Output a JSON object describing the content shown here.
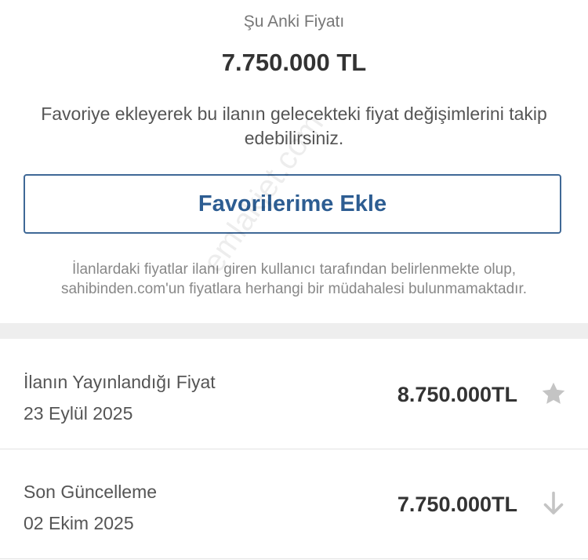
{
  "price_block": {
    "current_label": "Şu Anki Fiyatı",
    "current_price": "7.750.000 TL",
    "info_text": "Favoriye ekleyerek bu ilanın gelecekteki fiyat değişimlerini takip edebilirsiniz.",
    "favorite_button_label": "Favorilerime Ekle",
    "disclaimer": "İlanlardaki fiyatlar ilanı giren kullanıcı tarafından belirlenmekte olup, sahibinden.com'un fiyatlara herhangi bir müdahalesi bulunmamaktadır."
  },
  "history": [
    {
      "label": "İlanın Yayınlandığı Fiyat",
      "date": "23 Eylül 2025",
      "price": "8.750.000TL",
      "icon": "star-icon"
    },
    {
      "label": "Son Güncelleme",
      "date": "02 Ekim 2025",
      "price": "7.750.000TL",
      "icon": "arrow-down-icon"
    }
  ],
  "watermark": "emlakjet.com",
  "colors": {
    "accent": "#2d5d92",
    "icon_gray": "#c4c4c4",
    "band": "#eeeeee"
  }
}
